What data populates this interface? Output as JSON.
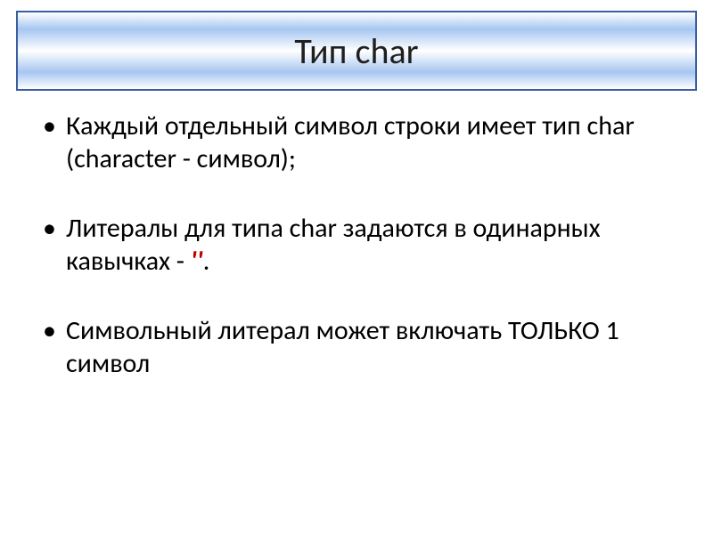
{
  "title": "Тип char",
  "bullets": [
    {
      "text": "Каждый отдельный символ строки имеет тип char (character - символ);"
    },
    {
      "prefix": "Литералы для типа char задаются в одинарных кавычках - ",
      "quotes": "''",
      "suffix": "."
    },
    {
      "text": "Символьный литерал может включать ТОЛЬКО 1 символ"
    }
  ]
}
